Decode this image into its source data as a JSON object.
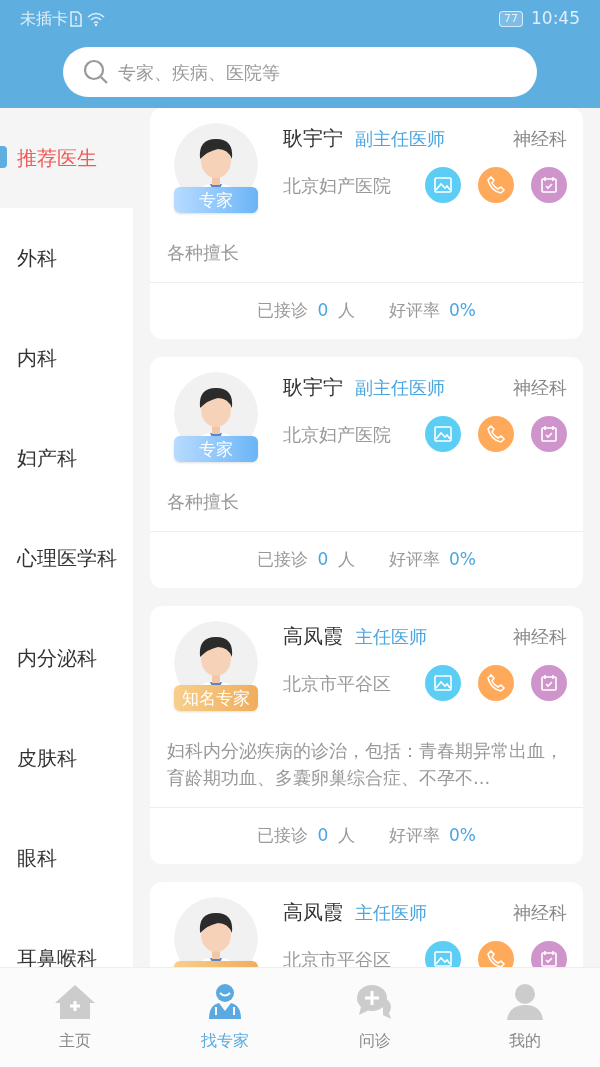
{
  "status_bar": {
    "carrier": "未插卡",
    "battery": "77",
    "time": "10:45"
  },
  "search": {
    "placeholder": "专家、疾病、医院等"
  },
  "sidebar": {
    "items": [
      {
        "label": "推荐医生",
        "selected": true
      },
      {
        "label": "外科",
        "selected": false
      },
      {
        "label": "内科",
        "selected": false
      },
      {
        "label": "妇产科",
        "selected": false
      },
      {
        "label": "心理医学科",
        "selected": false
      },
      {
        "label": "内分泌科",
        "selected": false
      },
      {
        "label": "皮肤科",
        "selected": false
      },
      {
        "label": "眼科",
        "selected": false
      },
      {
        "label": "耳鼻喉科",
        "selected": false
      }
    ]
  },
  "doctors": [
    {
      "name": "耿宇宁",
      "title": "副主任医师",
      "department": "神经科",
      "hospital": "北京妇产医院",
      "badge": {
        "text": "专家",
        "kind": "expert"
      },
      "description": "各种擅长",
      "consults_label": "已接诊",
      "consults": "0",
      "consults_unit": "人",
      "rating_label": "好评率",
      "rating": "0%"
    },
    {
      "name": "耿宇宁",
      "title": "副主任医师",
      "department": "神经科",
      "hospital": "北京妇产医院",
      "badge": {
        "text": "专家",
        "kind": "expert"
      },
      "description": "各种擅长",
      "consults_label": "已接诊",
      "consults": "0",
      "consults_unit": "人",
      "rating_label": "好评率",
      "rating": "0%"
    },
    {
      "name": "高凤霞",
      "title": "主任医师",
      "department": "神经科",
      "hospital": "北京市平谷区",
      "badge": {
        "text": "知名专家",
        "kind": "famous"
      },
      "description": "妇科内分泌疾病的诊治，包括：青春期异常出血，育龄期功血、多囊卵巢综合症、不孕不...",
      "consults_label": "已接诊",
      "consults": "0",
      "consults_unit": "人",
      "rating_label": "好评率",
      "rating": "0%"
    },
    {
      "name": "高凤霞",
      "title": "主任医师",
      "department": "神经科",
      "hospital": "北京市平谷区",
      "badge": {
        "kind": "famous"
      }
    }
  ],
  "bottom_nav": [
    {
      "label": "主页",
      "kind": "home",
      "selected": false
    },
    {
      "label": "找专家",
      "kind": "doctor",
      "selected": true
    },
    {
      "label": "问诊",
      "kind": "chat",
      "selected": false
    },
    {
      "label": "我的",
      "kind": "user",
      "selected": false
    }
  ]
}
